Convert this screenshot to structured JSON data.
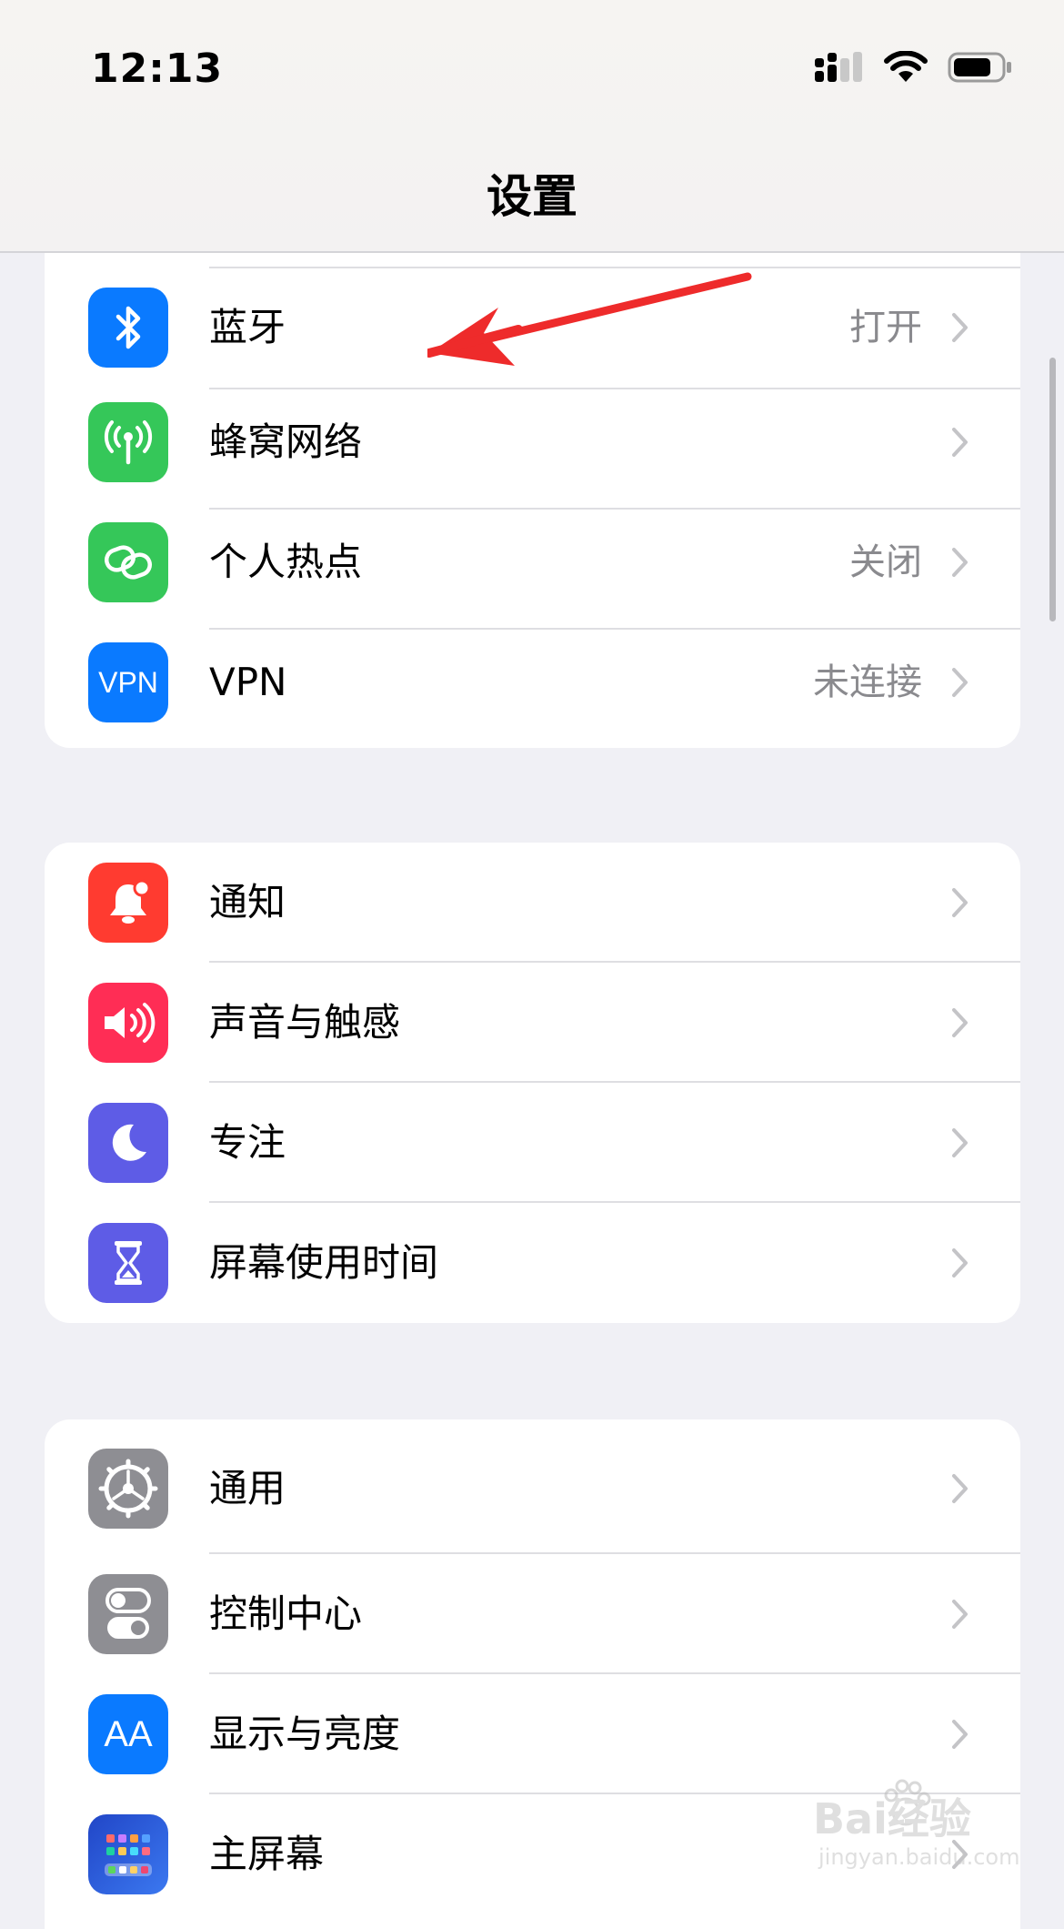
{
  "status_bar": {
    "time": "12:13"
  },
  "nav": {
    "title": "设置"
  },
  "group1": [
    {
      "label": "蓝牙",
      "value": "打开",
      "icon": "bluetooth-icon",
      "color": "#0a7aff"
    },
    {
      "label": "蜂窝网络",
      "value": "",
      "icon": "antenna-icon",
      "color": "#35c759"
    },
    {
      "label": "个人热点",
      "value": "关闭",
      "icon": "hotspot-link-icon",
      "color": "#35c759"
    },
    {
      "label": "VPN",
      "value": "未连接",
      "icon": "vpn-icon",
      "icon_text": "VPN",
      "color": "#0a7aff"
    }
  ],
  "group2": [
    {
      "label": "通知",
      "icon": "bell-icon",
      "color": "#ff3b30"
    },
    {
      "label": "声音与触感",
      "icon": "speaker-icon",
      "color": "#ff2d55"
    },
    {
      "label": "专注",
      "icon": "moon-icon",
      "color": "#5e5ce6"
    },
    {
      "label": "屏幕使用时间",
      "icon": "hourglass-icon",
      "color": "#5e5ce6"
    }
  ],
  "group3": [
    {
      "label": "通用",
      "icon": "gear-icon",
      "color": "#8e8e93"
    },
    {
      "label": "控制中心",
      "icon": "toggles-icon",
      "color": "#8e8e93"
    },
    {
      "label": "显示与亮度",
      "icon": "text-size-icon",
      "icon_text": "AA",
      "color": "#0a7aff"
    },
    {
      "label": "主屏幕",
      "icon": "home-screen-icon",
      "color": "#2c5ee8"
    }
  ],
  "watermark": {
    "text": "Bai经验",
    "sub": "jingyan.baidu.com"
  }
}
